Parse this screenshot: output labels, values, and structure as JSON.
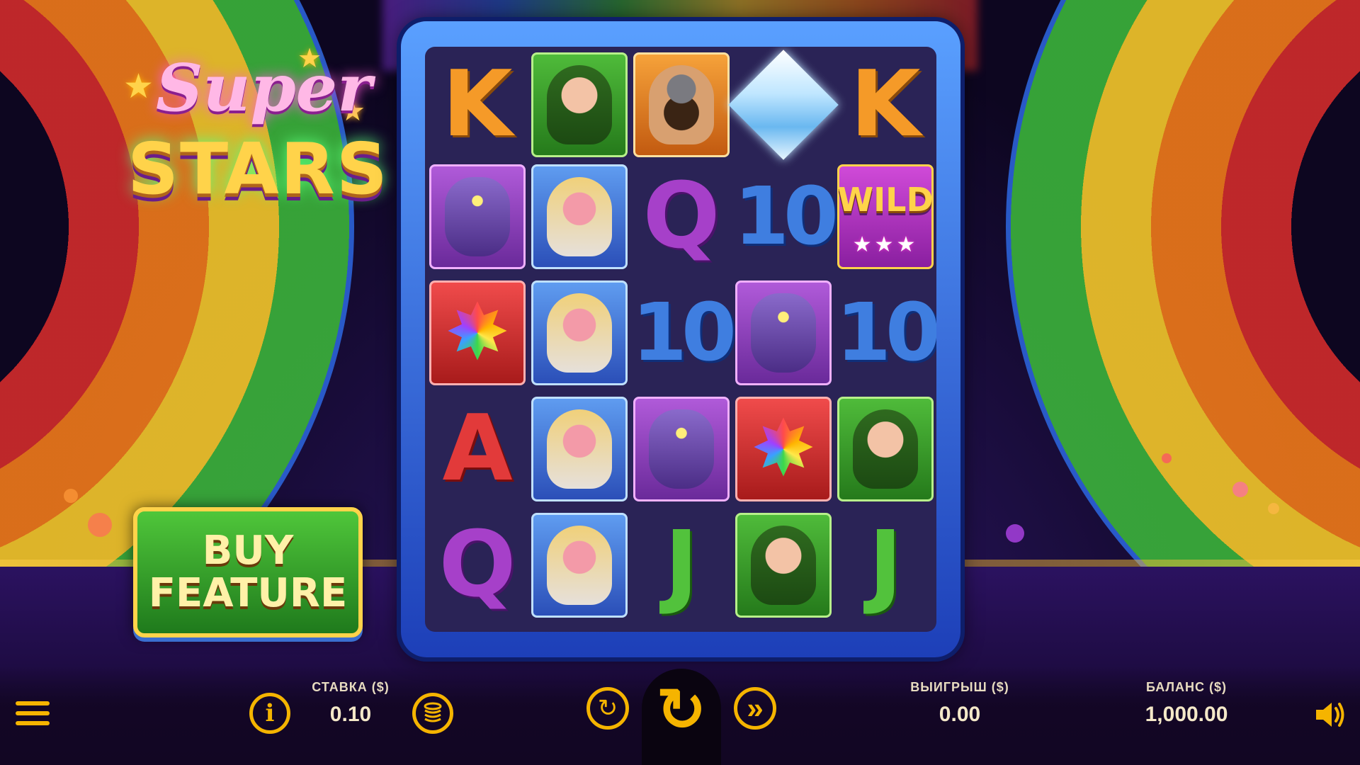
{
  "game": {
    "logo_top": "Super",
    "logo_bottom": "STARS",
    "buy_feature_line1": "BUY",
    "buy_feature_line2": "FEATURE"
  },
  "reels": {
    "rows": [
      [
        "K",
        "leprechaun",
        "dwarf",
        "diamond",
        "K"
      ],
      [
        "monster",
        "pig-lady",
        "Q",
        "10",
        "wild"
      ],
      [
        "star-gem",
        "pig-lady",
        "10",
        "monster",
        "10"
      ],
      [
        "A",
        "pig-lady",
        "monster",
        "star-gem",
        "leprechaun"
      ],
      [
        "Q",
        "pig-lady",
        "J",
        "leprechaun",
        "J"
      ]
    ],
    "wild_label": "WILD",
    "wild_stars": "★★★"
  },
  "controls": {
    "bet_label": "СТАВКА ($)",
    "bet_value": "0.10",
    "win_label": "ВЫИГРЫШ ($)",
    "win_value": "0.00",
    "balance_label": "БАЛАНС ($)",
    "balance_value": "1,000.00",
    "info_icon": "i",
    "autoplay_icon": "↻",
    "spin_icon": "↻",
    "turbo_icon": "»"
  },
  "colors": {
    "accent": "#f5b400",
    "text": "#f4e8c8"
  }
}
